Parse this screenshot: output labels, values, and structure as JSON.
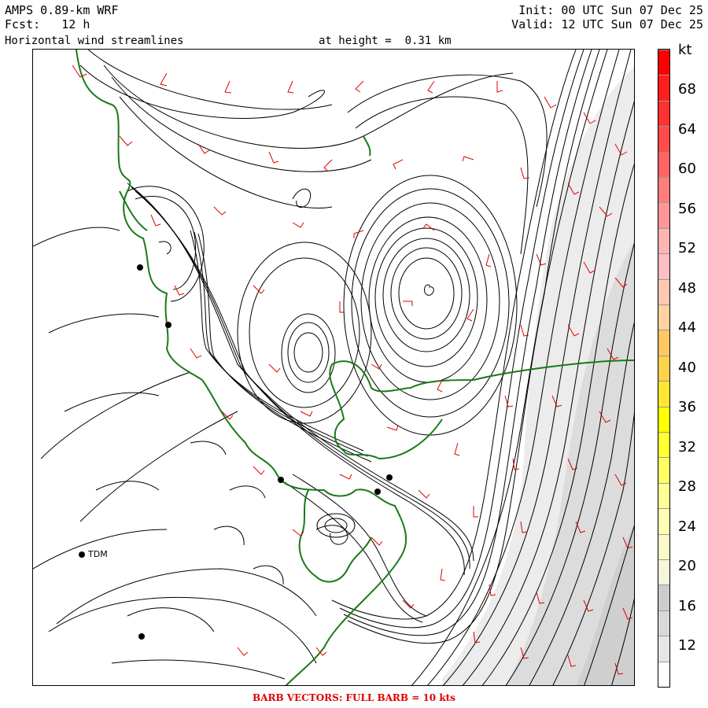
{
  "header": {
    "model": "AMPS 0.89-km WRF",
    "forecast": "Fcst:   12 h",
    "field": "Horizontal wind streamlines",
    "height": "at height =  0.31 km",
    "init": "Init: 00 UTC Sun 07 Dec 25",
    "valid": "Valid: 12 UTC Sun 07 Dec 25"
  },
  "footer": "BARB VECTORS:  FULL BARB = 10 kts",
  "map": {
    "station_label": "TDM",
    "colors": {
      "streamline": "#000000",
      "coastline": "#1a7a1a",
      "barb": "#e00000",
      "shading": "#cfcfcf"
    }
  },
  "colorbar": {
    "unit": "kt",
    "tick_labels": [
      "68",
      "64",
      "60",
      "56",
      "52",
      "48",
      "44",
      "40",
      "36",
      "32",
      "28",
      "24",
      "20",
      "16",
      "12"
    ],
    "colors": [
      "#ffffff",
      "#e6e6e6",
      "#d9d9d9",
      "#cccccc",
      "#f5f5dc",
      "#fafac8",
      "#ffffb4",
      "#ffff96",
      "#ffff64",
      "#ffff32",
      "#ffff00",
      "#ffe632",
      "#ffd24b",
      "#ffc864",
      "#ffd2a0",
      "#ffc8b4",
      "#ffbec3",
      "#ffb4b4",
      "#ff9696",
      "#ff7d7d",
      "#ff6464",
      "#ff4b4b",
      "#ff3232",
      "#ff1e1e",
      "#ff0000"
    ]
  }
}
